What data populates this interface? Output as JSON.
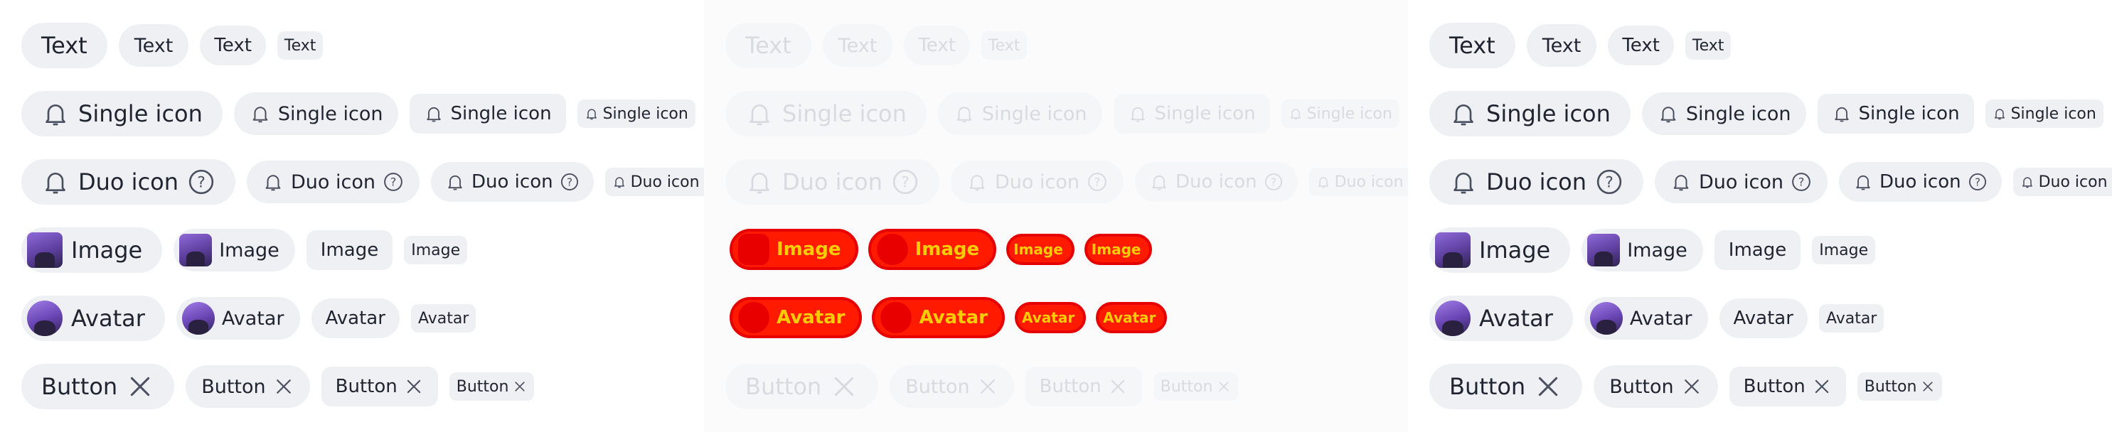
{
  "labels": {
    "text": "Text",
    "single_icon": "Single icon",
    "duo_icon": "Duo icon",
    "image": "Image",
    "avatar": "Avatar",
    "button": "Button"
  },
  "icons": {
    "leading": "bell-icon",
    "trailing_duo": "question-circle-icon",
    "trailing_button": "close-icon"
  },
  "colors": {
    "chip_bg": "#eef0f3",
    "chip_text": "#1f2430",
    "icon": "#4b5060",
    "disabled_text": "#d7dbe0",
    "glitch_red": "#ff1a00",
    "glitch_yellow": "#ffcc00"
  }
}
